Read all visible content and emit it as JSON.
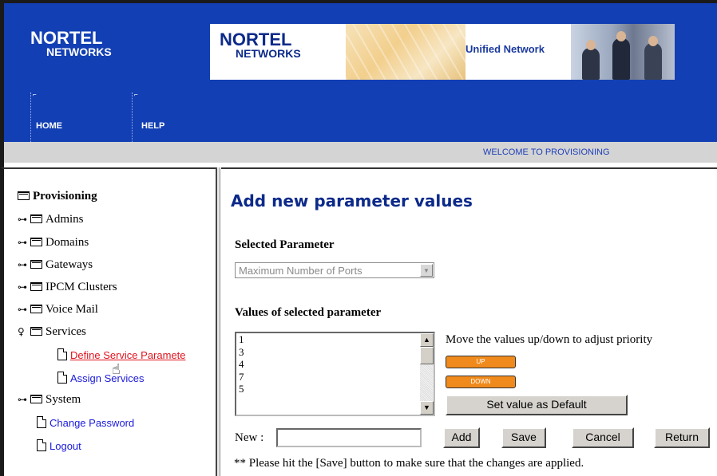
{
  "header": {
    "logo_line1": "NORTEL",
    "logo_line2": "NETWORKS",
    "banner_logo_line1": "NORTEL",
    "banner_logo_line2": "NETWORKS",
    "banner_tagline": "Unified Network",
    "nav": [
      {
        "label": "HOME",
        "icon": "broken-image-icon"
      },
      {
        "label": "HELP",
        "icon": "broken-image-icon"
      }
    ],
    "welcome": "WELCOME TO PROVISIONING"
  },
  "sidebar": {
    "root": "Provisioning",
    "items": [
      {
        "label": "Admins",
        "expander": "⊶"
      },
      {
        "label": "Domains",
        "expander": "⊶"
      },
      {
        "label": "Gateways",
        "expander": "⊶"
      },
      {
        "label": "IPCM Clusters",
        "expander": "⊶"
      },
      {
        "label": "Voice Mail",
        "expander": "⊶"
      },
      {
        "label": "Services",
        "expander": "♀"
      }
    ],
    "services_children": [
      {
        "label": "Define Service Paramete",
        "state": "active"
      },
      {
        "label": "Assign Services"
      }
    ],
    "system": {
      "label": "System",
      "expander": "⊶"
    },
    "links": [
      {
        "label": "Change Password"
      },
      {
        "label": "Logout"
      }
    ]
  },
  "main": {
    "title": "Add new parameter values",
    "selected_parameter_label": "Selected Parameter",
    "selected_parameter_value": "Maximum Number of Ports",
    "values_label": "Values of selected parameter",
    "values": [
      "1",
      "3",
      "4",
      "7",
      "5"
    ],
    "move_hint": "Move the values up/down to adjust priority",
    "up_label": "UP",
    "down_label": "DOWN",
    "set_default_label": "Set value as Default",
    "new_label": "New :",
    "new_value": "",
    "buttons": {
      "add": "Add",
      "save": "Save",
      "cancel": "Cancel",
      "return": "Return"
    },
    "note": "** Please hit the [Save] button to make sure that the changes are applied."
  },
  "colors": {
    "header_blue": "#123fb3",
    "title_blue": "#0c2a8a",
    "link_blue": "#1a1adb",
    "active_red": "#e0141e",
    "orange_button": "#f08a1c"
  }
}
